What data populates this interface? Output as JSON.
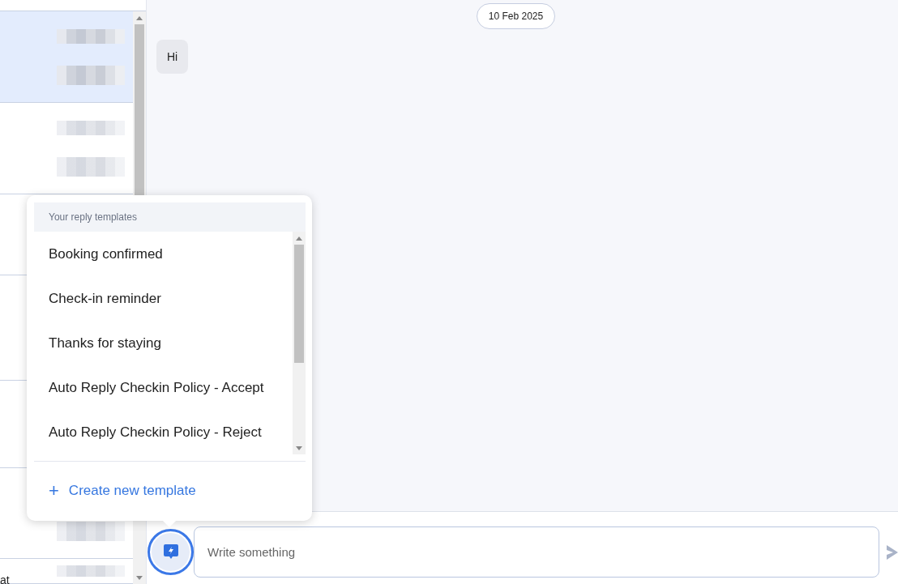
{
  "conversations": [
    {
      "selected": true
    },
    {
      "selected": false
    },
    {
      "selected": false
    },
    {
      "selected": false
    },
    {
      "selected": false
    },
    {
      "selected": false
    },
    {
      "selected": false,
      "snippet": "at"
    }
  ],
  "chat": {
    "date": "10 Feb 2025",
    "messages": [
      {
        "text": "Hi"
      }
    ]
  },
  "templates_popover": {
    "title": "Your reply templates",
    "items": [
      "Booking confirmed",
      "Check-in reminder",
      "Thanks for staying",
      "Auto Reply Checkin Policy - Accept",
      "Auto Reply Checkin Policy - Reject"
    ],
    "create": {
      "icon": "+",
      "label": "Create new template"
    }
  },
  "composer": {
    "placeholder": "Write something",
    "templates_open": true
  }
}
